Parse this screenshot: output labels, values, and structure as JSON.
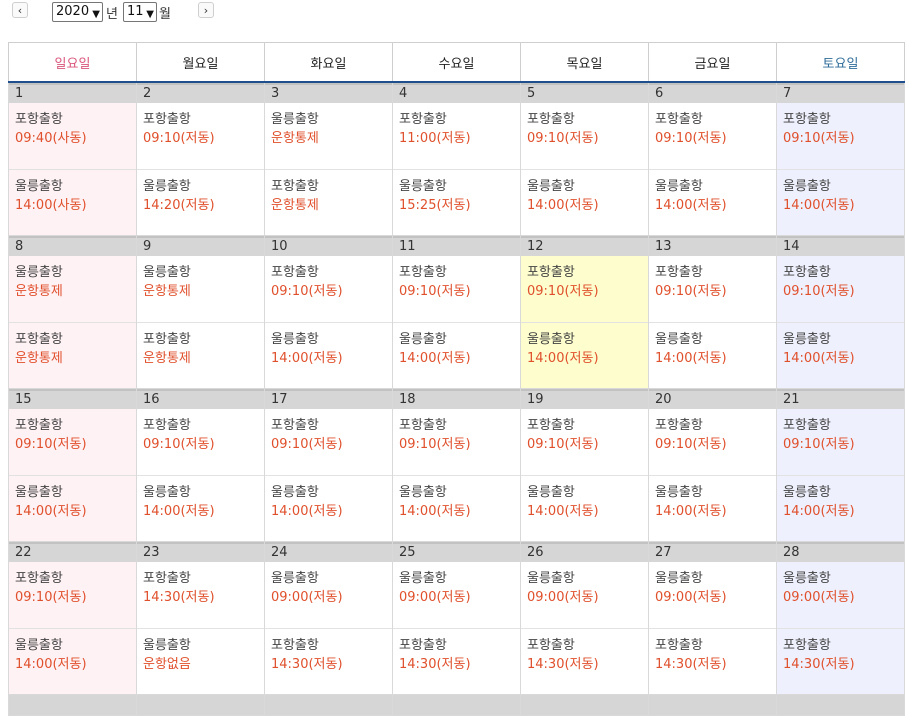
{
  "nav": {
    "prev_label": "‹",
    "next_label": "›",
    "year_value": "2020",
    "year_unit": "년",
    "month_value": "11",
    "month_unit": "월"
  },
  "weekdays": [
    "일요일",
    "월요일",
    "화요일",
    "수요일",
    "목요일",
    "금요일",
    "토요일"
  ],
  "colors": {
    "sunday_header": "#d9557a",
    "saturday_header": "#2f6d9a",
    "time_text": "#e0502c",
    "today_bg": "#fdfdcd",
    "header_rule": "#1f4e8c"
  },
  "weeks": [
    [
      {
        "day": "1",
        "trips": [
          {
            "route": "포항출항",
            "time": "09:40(사동)"
          },
          {
            "route": "울릉출항",
            "time": "14:00(사동)"
          }
        ]
      },
      {
        "day": "2",
        "trips": [
          {
            "route": "포항출항",
            "time": "09:10(저동)"
          },
          {
            "route": "울릉출항",
            "time": "14:20(저동)"
          }
        ]
      },
      {
        "day": "3",
        "trips": [
          {
            "route": "울릉출항",
            "time": "운항통제"
          },
          {
            "route": "포항출항",
            "time": "운항통제"
          }
        ]
      },
      {
        "day": "4",
        "trips": [
          {
            "route": "포항출항",
            "time": "11:00(저동)"
          },
          {
            "route": "울릉출항",
            "time": "15:25(저동)"
          }
        ]
      },
      {
        "day": "5",
        "trips": [
          {
            "route": "포항출항",
            "time": "09:10(저동)"
          },
          {
            "route": "울릉출항",
            "time": "14:00(저동)"
          }
        ]
      },
      {
        "day": "6",
        "trips": [
          {
            "route": "포항출항",
            "time": "09:10(저동)"
          },
          {
            "route": "울릉출항",
            "time": "14:00(저동)"
          }
        ]
      },
      {
        "day": "7",
        "trips": [
          {
            "route": "포항출항",
            "time": "09:10(저동)"
          },
          {
            "route": "울릉출항",
            "time": "14:00(저동)"
          }
        ]
      }
    ],
    [
      {
        "day": "8",
        "trips": [
          {
            "route": "울릉출항",
            "time": "운항통제"
          },
          {
            "route": "포항출항",
            "time": "운항통제"
          }
        ]
      },
      {
        "day": "9",
        "trips": [
          {
            "route": "울릉출항",
            "time": "운항통제"
          },
          {
            "route": "포항출항",
            "time": "운항통제"
          }
        ]
      },
      {
        "day": "10",
        "trips": [
          {
            "route": "포항출항",
            "time": "09:10(저동)"
          },
          {
            "route": "울릉출항",
            "time": "14:00(저동)"
          }
        ]
      },
      {
        "day": "11",
        "trips": [
          {
            "route": "포항출항",
            "time": "09:10(저동)"
          },
          {
            "route": "울릉출항",
            "time": "14:00(저동)"
          }
        ]
      },
      {
        "day": "12",
        "today": true,
        "trips": [
          {
            "route": "포항출항",
            "time": "09:10(저동)"
          },
          {
            "route": "울릉출항",
            "time": "14:00(저동)"
          }
        ]
      },
      {
        "day": "13",
        "trips": [
          {
            "route": "포항출항",
            "time": "09:10(저동)"
          },
          {
            "route": "울릉출항",
            "time": "14:00(저동)"
          }
        ]
      },
      {
        "day": "14",
        "trips": [
          {
            "route": "포항출항",
            "time": "09:10(저동)"
          },
          {
            "route": "울릉출항",
            "time": "14:00(저동)"
          }
        ]
      }
    ],
    [
      {
        "day": "15",
        "trips": [
          {
            "route": "포항출항",
            "time": "09:10(저동)"
          },
          {
            "route": "울릉출항",
            "time": "14:00(저동)"
          }
        ]
      },
      {
        "day": "16",
        "trips": [
          {
            "route": "포항출항",
            "time": "09:10(저동)"
          },
          {
            "route": "울릉출항",
            "time": "14:00(저동)"
          }
        ]
      },
      {
        "day": "17",
        "trips": [
          {
            "route": "포항출항",
            "time": "09:10(저동)"
          },
          {
            "route": "울릉출항",
            "time": "14:00(저동)"
          }
        ]
      },
      {
        "day": "18",
        "trips": [
          {
            "route": "포항출항",
            "time": "09:10(저동)"
          },
          {
            "route": "울릉출항",
            "time": "14:00(저동)"
          }
        ]
      },
      {
        "day": "19",
        "trips": [
          {
            "route": "포항출항",
            "time": "09:10(저동)"
          },
          {
            "route": "울릉출항",
            "time": "14:00(저동)"
          }
        ]
      },
      {
        "day": "20",
        "trips": [
          {
            "route": "포항출항",
            "time": "09:10(저동)"
          },
          {
            "route": "울릉출항",
            "time": "14:00(저동)"
          }
        ]
      },
      {
        "day": "21",
        "trips": [
          {
            "route": "포항출항",
            "time": "09:10(저동)"
          },
          {
            "route": "울릉출항",
            "time": "14:00(저동)"
          }
        ]
      }
    ],
    [
      {
        "day": "22",
        "trips": [
          {
            "route": "포항출항",
            "time": "09:10(저동)"
          },
          {
            "route": "울릉출항",
            "time": "14:00(저동)"
          }
        ]
      },
      {
        "day": "23",
        "trips": [
          {
            "route": "포항출항",
            "time": "14:30(저동)"
          },
          {
            "route": "울릉출항",
            "time": "운항없음"
          }
        ]
      },
      {
        "day": "24",
        "trips": [
          {
            "route": "울릉출항",
            "time": "09:00(저동)"
          },
          {
            "route": "포항출항",
            "time": "14:30(저동)"
          }
        ]
      },
      {
        "day": "25",
        "trips": [
          {
            "route": "울릉출항",
            "time": "09:00(저동)"
          },
          {
            "route": "포항출항",
            "time": "14:30(저동)"
          }
        ]
      },
      {
        "day": "26",
        "trips": [
          {
            "route": "울릉출항",
            "time": "09:00(저동)"
          },
          {
            "route": "포항출항",
            "time": "14:30(저동)"
          }
        ]
      },
      {
        "day": "27",
        "trips": [
          {
            "route": "울릉출항",
            "time": "09:00(저동)"
          },
          {
            "route": "포항출항",
            "time": "14:30(저동)"
          }
        ]
      },
      {
        "day": "28",
        "trips": [
          {
            "route": "울릉출항",
            "time": "09:00(저동)"
          },
          {
            "route": "포항출항",
            "time": "14:30(저동)"
          }
        ]
      }
    ]
  ]
}
